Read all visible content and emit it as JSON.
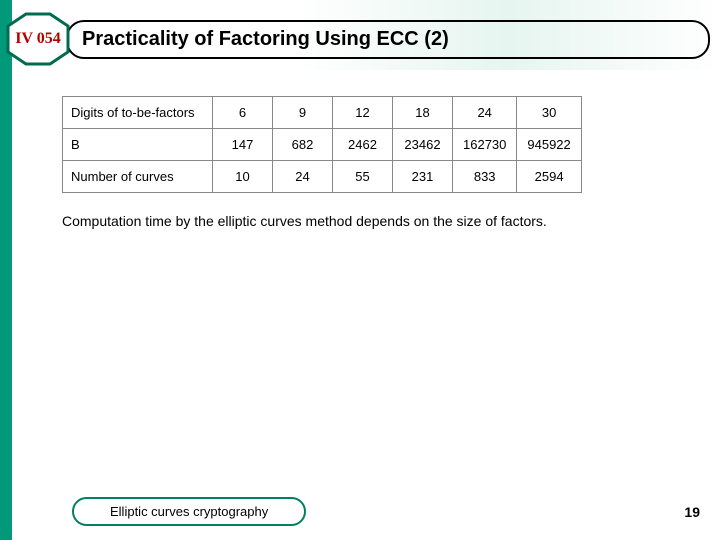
{
  "badge": "IV 054",
  "title": "Practicality of Factoring Using ECC (2)",
  "chart_data": {
    "type": "table",
    "rows": [
      {
        "label": "Digits of to-be-factors",
        "values": [
          "6",
          "9",
          "12",
          "18",
          "24",
          "30"
        ]
      },
      {
        "label": "B",
        "values": [
          "147",
          "682",
          "2462",
          "23462",
          "162730",
          "945922"
        ]
      },
      {
        "label": "Number of curves",
        "values": [
          "10",
          "24",
          "55",
          "231",
          "833",
          "2594"
        ]
      }
    ]
  },
  "caption": "Computation time by the elliptic curves method depends on the size of factors.",
  "footer_label": "Elliptic curves cryptography",
  "page_number": "19"
}
